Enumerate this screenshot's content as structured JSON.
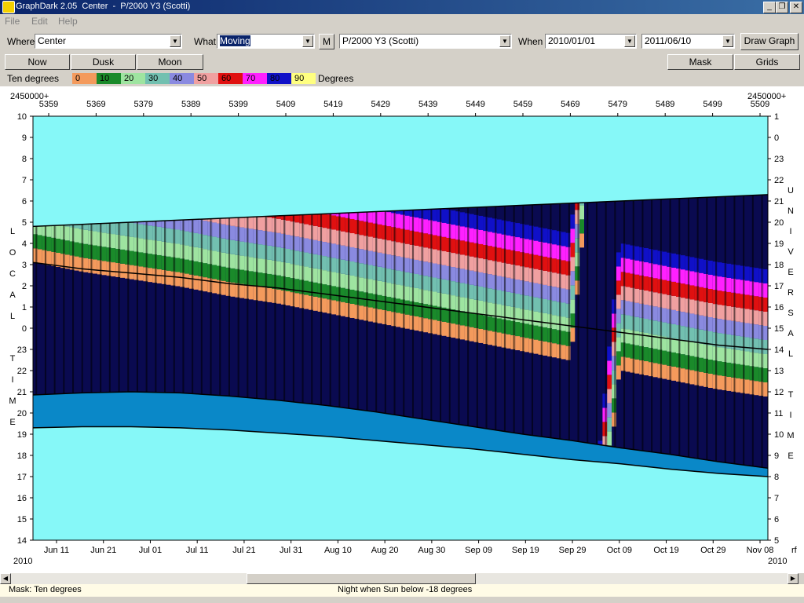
{
  "window": {
    "title": "GraphDark 2.05  Center  -  P/2000 Y3 (Scotti)"
  },
  "menu": [
    "File",
    "Edit",
    "Help"
  ],
  "toolbar": {
    "where_label": "Where",
    "where_value": "Center",
    "what_label": "What",
    "what_value": "Moving",
    "m_button": "M",
    "object_value": "P/2000 Y3 (Scotti)",
    "when_label": "When",
    "date_from": "2010/01/01",
    "date_to": "2011/06/10",
    "draw_button": "Draw Graph"
  },
  "buttons": {
    "now": "Now",
    "dusk": "Dusk",
    "moon": "Moon",
    "mask": "Mask",
    "grids": "Grids"
  },
  "legend": {
    "title": "Ten degrees",
    "unit": "Degrees",
    "items": [
      {
        "label": "0",
        "color": "#f49a5c"
      },
      {
        "label": "10",
        "color": "#1a8a2a"
      },
      {
        "label": "20",
        "color": "#9ee4a0"
      },
      {
        "label": "30",
        "color": "#72c0b0"
      },
      {
        "label": "40",
        "color": "#8a8ae0"
      },
      {
        "label": "50",
        "color": "#f0a0a0"
      },
      {
        "label": "60",
        "color": "#e01010"
      },
      {
        "label": "70",
        "color": "#ff20ff"
      },
      {
        "label": "80",
        "color": "#1010c8"
      },
      {
        "label": "90",
        "color": "#ffff80"
      }
    ]
  },
  "chart_data": {
    "type": "heatmap",
    "jd_prefix_left": "2450000+",
    "jd_prefix_right": "2450000+",
    "top_ticks": [
      "5359",
      "5369",
      "5379",
      "5389",
      "5399",
      "5409",
      "5419",
      "5429",
      "5439",
      "5449",
      "5459",
      "5469",
      "5479",
      "5489",
      "5499",
      "5509"
    ],
    "bottom_ticks": [
      "Jun 11",
      "Jun 21",
      "Jul 01",
      "Jul 11",
      "Jul 21",
      "Jul 31",
      "Aug 10",
      "Aug 20",
      "Aug 30",
      "Sep 09",
      "Sep 19",
      "Sep 29",
      "Oct 09",
      "Oct 19",
      "Oct 29",
      "Nov 08"
    ],
    "year_left": "2010",
    "year_right": "2010",
    "bottom_right_mark": "rf",
    "left_axis_label": "LOCAL TIME",
    "left_ticks": [
      "10",
      "9",
      "8",
      "7",
      "6",
      "5",
      "4",
      "3",
      "2",
      "1",
      "0",
      "23",
      "22",
      "21",
      "20",
      "19",
      "18",
      "17",
      "16",
      "15",
      "14"
    ],
    "right_axis_label": "UNIVERSAL TIME",
    "right_ticks": [
      "1",
      "0",
      "23",
      "22",
      "21",
      "20",
      "19",
      "18",
      "17",
      "16",
      "15",
      "14",
      "13",
      "12",
      "11",
      "10",
      "9",
      "8",
      "7",
      "6",
      "5"
    ],
    "day_bg_color": "#86f8f8",
    "twilight_color": "#0a88c8",
    "night_dark_color": "#0a0a50",
    "moon_color": "#c8c8d8",
    "night_start_hours": [
      20.85,
      20.95,
      21.0,
      20.95,
      20.8,
      20.6,
      20.35,
      20.05,
      19.7,
      19.35,
      19.0,
      18.7,
      18.35,
      18.05,
      17.7,
      17.4
    ],
    "night_end_hours": [
      4.8,
      4.9,
      5.0,
      5.1,
      5.2,
      5.3,
      5.4,
      5.5,
      5.6,
      5.7,
      5.8,
      5.9,
      6.0,
      6.1,
      6.2,
      6.3
    ],
    "twilight_start_hours": [
      19.3,
      19.35,
      19.35,
      19.3,
      19.2,
      19.05,
      18.9,
      18.7,
      18.5,
      18.3,
      18.05,
      17.8,
      17.6,
      17.35,
      17.15,
      17.0
    ],
    "object_rise_hours": [
      3.1,
      2.8,
      2.6,
      2.4,
      2.1,
      1.9,
      1.6,
      1.3,
      1.0,
      0.7,
      0.4,
      0.1,
      23.8,
      23.5,
      23.2,
      23.0
    ]
  },
  "status": {
    "mask": "Mask:  Ten degrees",
    "night": "Night when Sun below -18 degrees"
  }
}
